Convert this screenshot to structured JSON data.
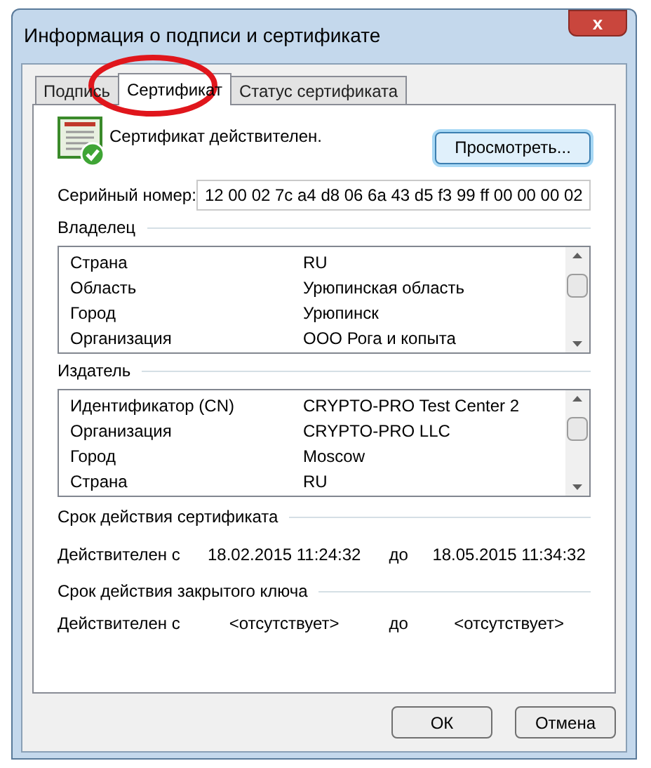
{
  "window": {
    "title": "Информация о подписи и сертификате",
    "close": "x"
  },
  "tabs": [
    {
      "label": "Подпись",
      "selected": false
    },
    {
      "label": "Сертификат",
      "selected": true
    },
    {
      "label": "Статус сертификата",
      "selected": false
    }
  ],
  "status": "Сертификат действителен.",
  "view_button": "Просмотреть...",
  "serial": {
    "label": "Серийный номер:",
    "value": "12 00 02 7c a4 d8 06 6a 43 d5 f3 99 ff 00 00 00 02"
  },
  "owner": {
    "title": "Владелец",
    "rows": [
      [
        "Страна",
        "RU"
      ],
      [
        "Область",
        "Урюпинская область"
      ],
      [
        "Город",
        "Урюпинск"
      ],
      [
        "Организация",
        "ООО Рога и копыта"
      ]
    ]
  },
  "issuer": {
    "title": "Издатель",
    "rows": [
      [
        "Идентификатор (CN)",
        "CRYPTO-PRO Test Center 2"
      ],
      [
        "Организация",
        "CRYPTO-PRO LLC"
      ],
      [
        "Город",
        "Moscow"
      ],
      [
        "Страна",
        "RU"
      ]
    ]
  },
  "validity": [
    {
      "title": "Срок действия сертификата",
      "from_label": "Действителен с",
      "from": "18.02.2015 11:24:32",
      "to_label": "до",
      "to": "18.05.2015 11:34:32"
    },
    {
      "title": "Срок действия закрытого ключа",
      "from_label": "Действителен с",
      "from": "<отсутствует>",
      "to_label": "до",
      "to": "<отсутствует>"
    }
  ],
  "buttons": [
    "ОК",
    "Отмена"
  ]
}
